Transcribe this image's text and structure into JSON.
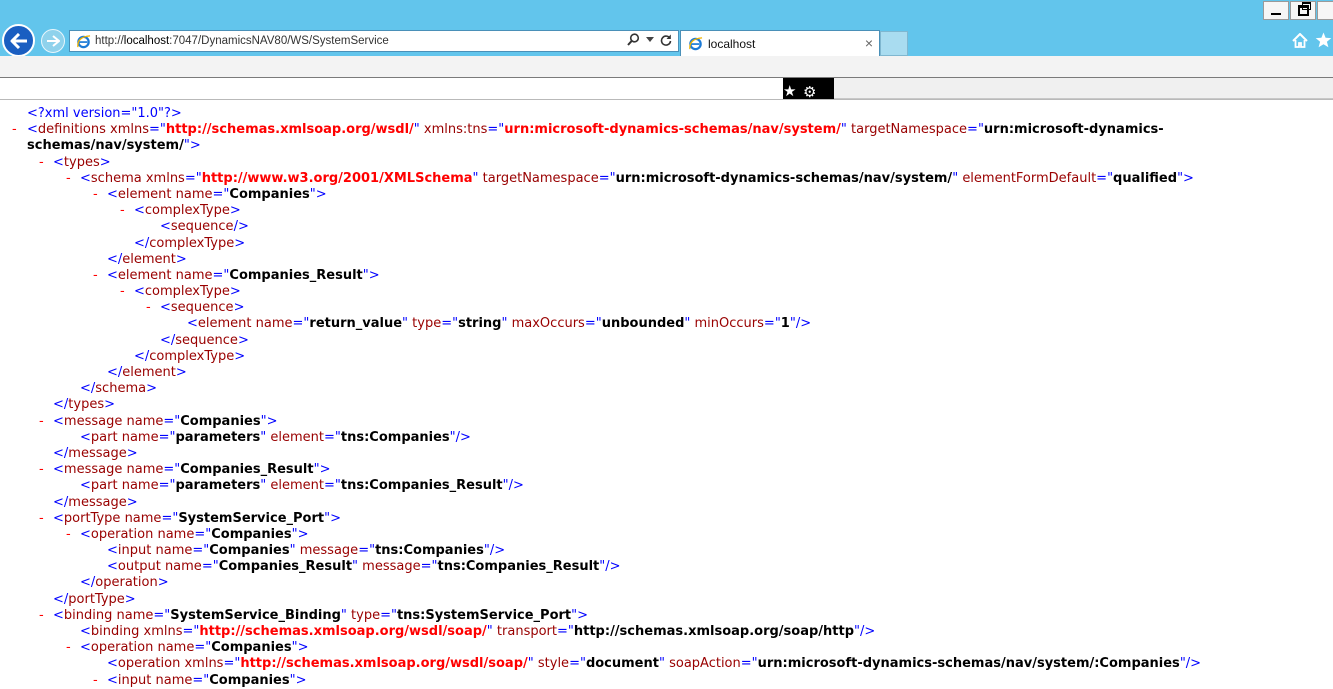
{
  "window_controls": {
    "minimize": "minimize",
    "restore": "restore",
    "close": "close"
  },
  "address_bar": {
    "url_prefix": "http://",
    "host": "localhost",
    "url_rest": ":7047/DynamicsNAV80/WS/SystemService",
    "search_icon": "search-icon",
    "refresh_icon": "refresh-icon"
  },
  "tab": {
    "title": "localhost",
    "close_glyph": "×"
  },
  "colors": {
    "chrome": "#62c5ec",
    "tag": "#990000",
    "bracket": "#0000ff",
    "namespace": "#ff0000"
  },
  "xml": {
    "l1": "<?xml version=\"1.0\"?>",
    "l2_t": "definitions",
    "l2_a1": "xmlns",
    "l2_v1": "http://schemas.xmlsoap.org/wsdl/",
    "l2_a2": "xmlns:tns",
    "l2_v2": "urn:microsoft-dynamics-schemas/nav/system/",
    "l2_a3": "targetNamespace",
    "l2_v3": "urn:microsoft-dynamics-schemas/nav/system/",
    "types": "types",
    "schema_t": "schema",
    "schema_a1": "xmlns",
    "schema_v1": "http://www.w3.org/2001/XMLSchema",
    "schema_a2": "targetNamespace",
    "schema_v2": "urn:microsoft-dynamics-schemas/nav/system/",
    "schema_a3": "elementFormDefault",
    "schema_v3": "qualified",
    "element": "element",
    "name": "name",
    "type": "type",
    "companies": "Companies",
    "companies_result": "Companies_Result",
    "complexType": "complexType",
    "sequence": "sequence",
    "return_value": "return_value",
    "string": "string",
    "maxOccurs": "maxOccurs",
    "unbounded": "unbounded",
    "minOccurs": "minOccurs",
    "one": "1",
    "message": "message",
    "part": "part",
    "parameters": "parameters",
    "tns_companies": "tns:Companies",
    "tns_companies_result": "tns:Companies_Result",
    "portType": "portType",
    "ssp": "SystemService_Port",
    "operation": "operation",
    "input": "input",
    "output": "output",
    "binding": "binding",
    "ssb": "SystemService_Binding",
    "tns_ssp": "tns:SystemService_Port",
    "soap_ns": "http://schemas.xmlsoap.org/wsdl/soap/",
    "transport": "transport",
    "transport_v": "http://schemas.xmlsoap.org/soap/http",
    "style": "style",
    "document": "document",
    "soapAction": "soapAction",
    "soapAction_v": "urn:microsoft-dynamics-schemas/nav/system/:Companies"
  }
}
